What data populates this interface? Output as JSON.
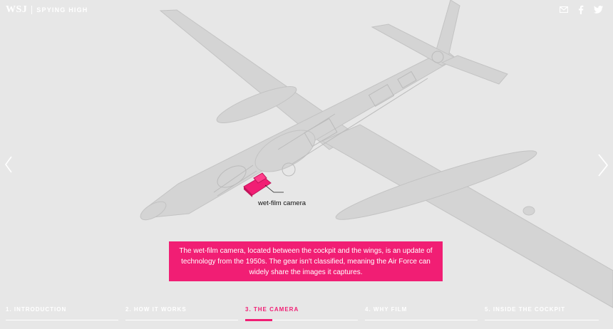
{
  "header": {
    "logo": "WSJ",
    "section_title": "SPYING HIGH",
    "share_icons": [
      "email-icon",
      "facebook-icon",
      "twitter-icon"
    ]
  },
  "navigation": {
    "prev_icon": "chevron-left-icon",
    "next_icon": "chevron-right-icon"
  },
  "callout": {
    "label": "wet-film camera",
    "highlight_color": "#f11e74"
  },
  "caption": {
    "text": "The wet-film camera, located between the cockpit and the wings, is an update of technology from the 1950s. The gear isn't classified, meaning the Air Force can widely share the images it captures.",
    "background": "#f11e74"
  },
  "chapters": [
    {
      "label": "1. INTRODUCTION",
      "active": false
    },
    {
      "label": "2. HOW IT WORKS",
      "active": false
    },
    {
      "label": "3. THE CAMERA",
      "active": true,
      "progress": 0.24
    },
    {
      "label": "4. WHY FILM",
      "active": false
    },
    {
      "label": "5. INSIDE THE COCKPIT",
      "active": false
    }
  ],
  "colors": {
    "background": "#e7e7e7",
    "aircraft": "#d2d2d2",
    "accent": "#f11e74"
  }
}
